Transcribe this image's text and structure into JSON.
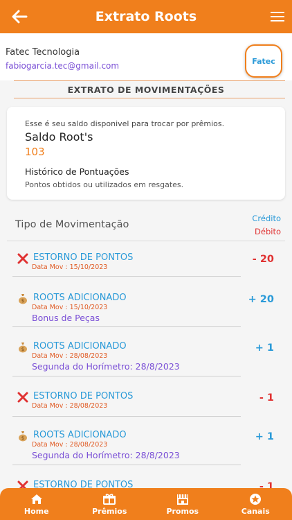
{
  "header": {
    "title": "Extrato Roots"
  },
  "user": {
    "name": "Fatec Tecnologia",
    "email": "fabiogarcia.tec@gmail.com",
    "logo_text": "Fatec"
  },
  "section": {
    "title": "EXTRATO DE MOVIMENTAÇÕES"
  },
  "balance": {
    "description": "Esse é seu saldo disponivel para trocar por prêmios.",
    "label": "Saldo Root's",
    "value": "103",
    "history_title": "Histórico de Pontuações",
    "history_desc": "Pontos obtidos ou utilizados em resgates."
  },
  "movements_header": {
    "title": "Tipo de Movimentação",
    "credit": "Crédito",
    "debit": "Débito"
  },
  "movements": [
    {
      "kind": "debit",
      "icon": "x-icon",
      "type": "ESTORNO DE PONTOS",
      "date": "Data Mov : 15/10/2023",
      "note": "",
      "amount": "- 20"
    },
    {
      "kind": "credit",
      "icon": "money-bag-icon",
      "type": "ROOTS ADICIONADO",
      "date": "Data Mov : 15/10/2023",
      "note": "Bonus de Peças",
      "amount": "+ 20"
    },
    {
      "kind": "credit",
      "icon": "money-bag-icon",
      "type": "ROOTS ADICIONADO",
      "date": "Data Mov : 28/08/2023",
      "note": "Segunda do Horímetro: 28/8/2023",
      "amount": "+ 1"
    },
    {
      "kind": "debit",
      "icon": "x-icon",
      "type": "ESTORNO DE PONTOS",
      "date": "Data Mov : 28/08/2023",
      "note": "",
      "amount": "- 1"
    },
    {
      "kind": "credit",
      "icon": "money-bag-icon",
      "type": "ROOTS ADICIONADO",
      "date": "Data Mov : 28/08/2023",
      "note": "Segunda do Horímetro: 28/8/2023",
      "amount": "+ 1"
    },
    {
      "kind": "debit",
      "icon": "x-icon",
      "type": "ESTORNO DE PONTOS",
      "date": "",
      "note": "",
      "amount": "- 1"
    }
  ],
  "nav": [
    {
      "label": "Home",
      "icon": "home-icon"
    },
    {
      "label": "Prêmios",
      "icon": "gift-icon"
    },
    {
      "label": "Promos",
      "icon": "store-icon"
    },
    {
      "label": "Canais",
      "icon": "star-badge-icon"
    }
  ],
  "colors": {
    "primary": "#f07f1c",
    "credit": "#2a9ad8",
    "debit": "#e03232",
    "note": "#7a4fd6"
  }
}
